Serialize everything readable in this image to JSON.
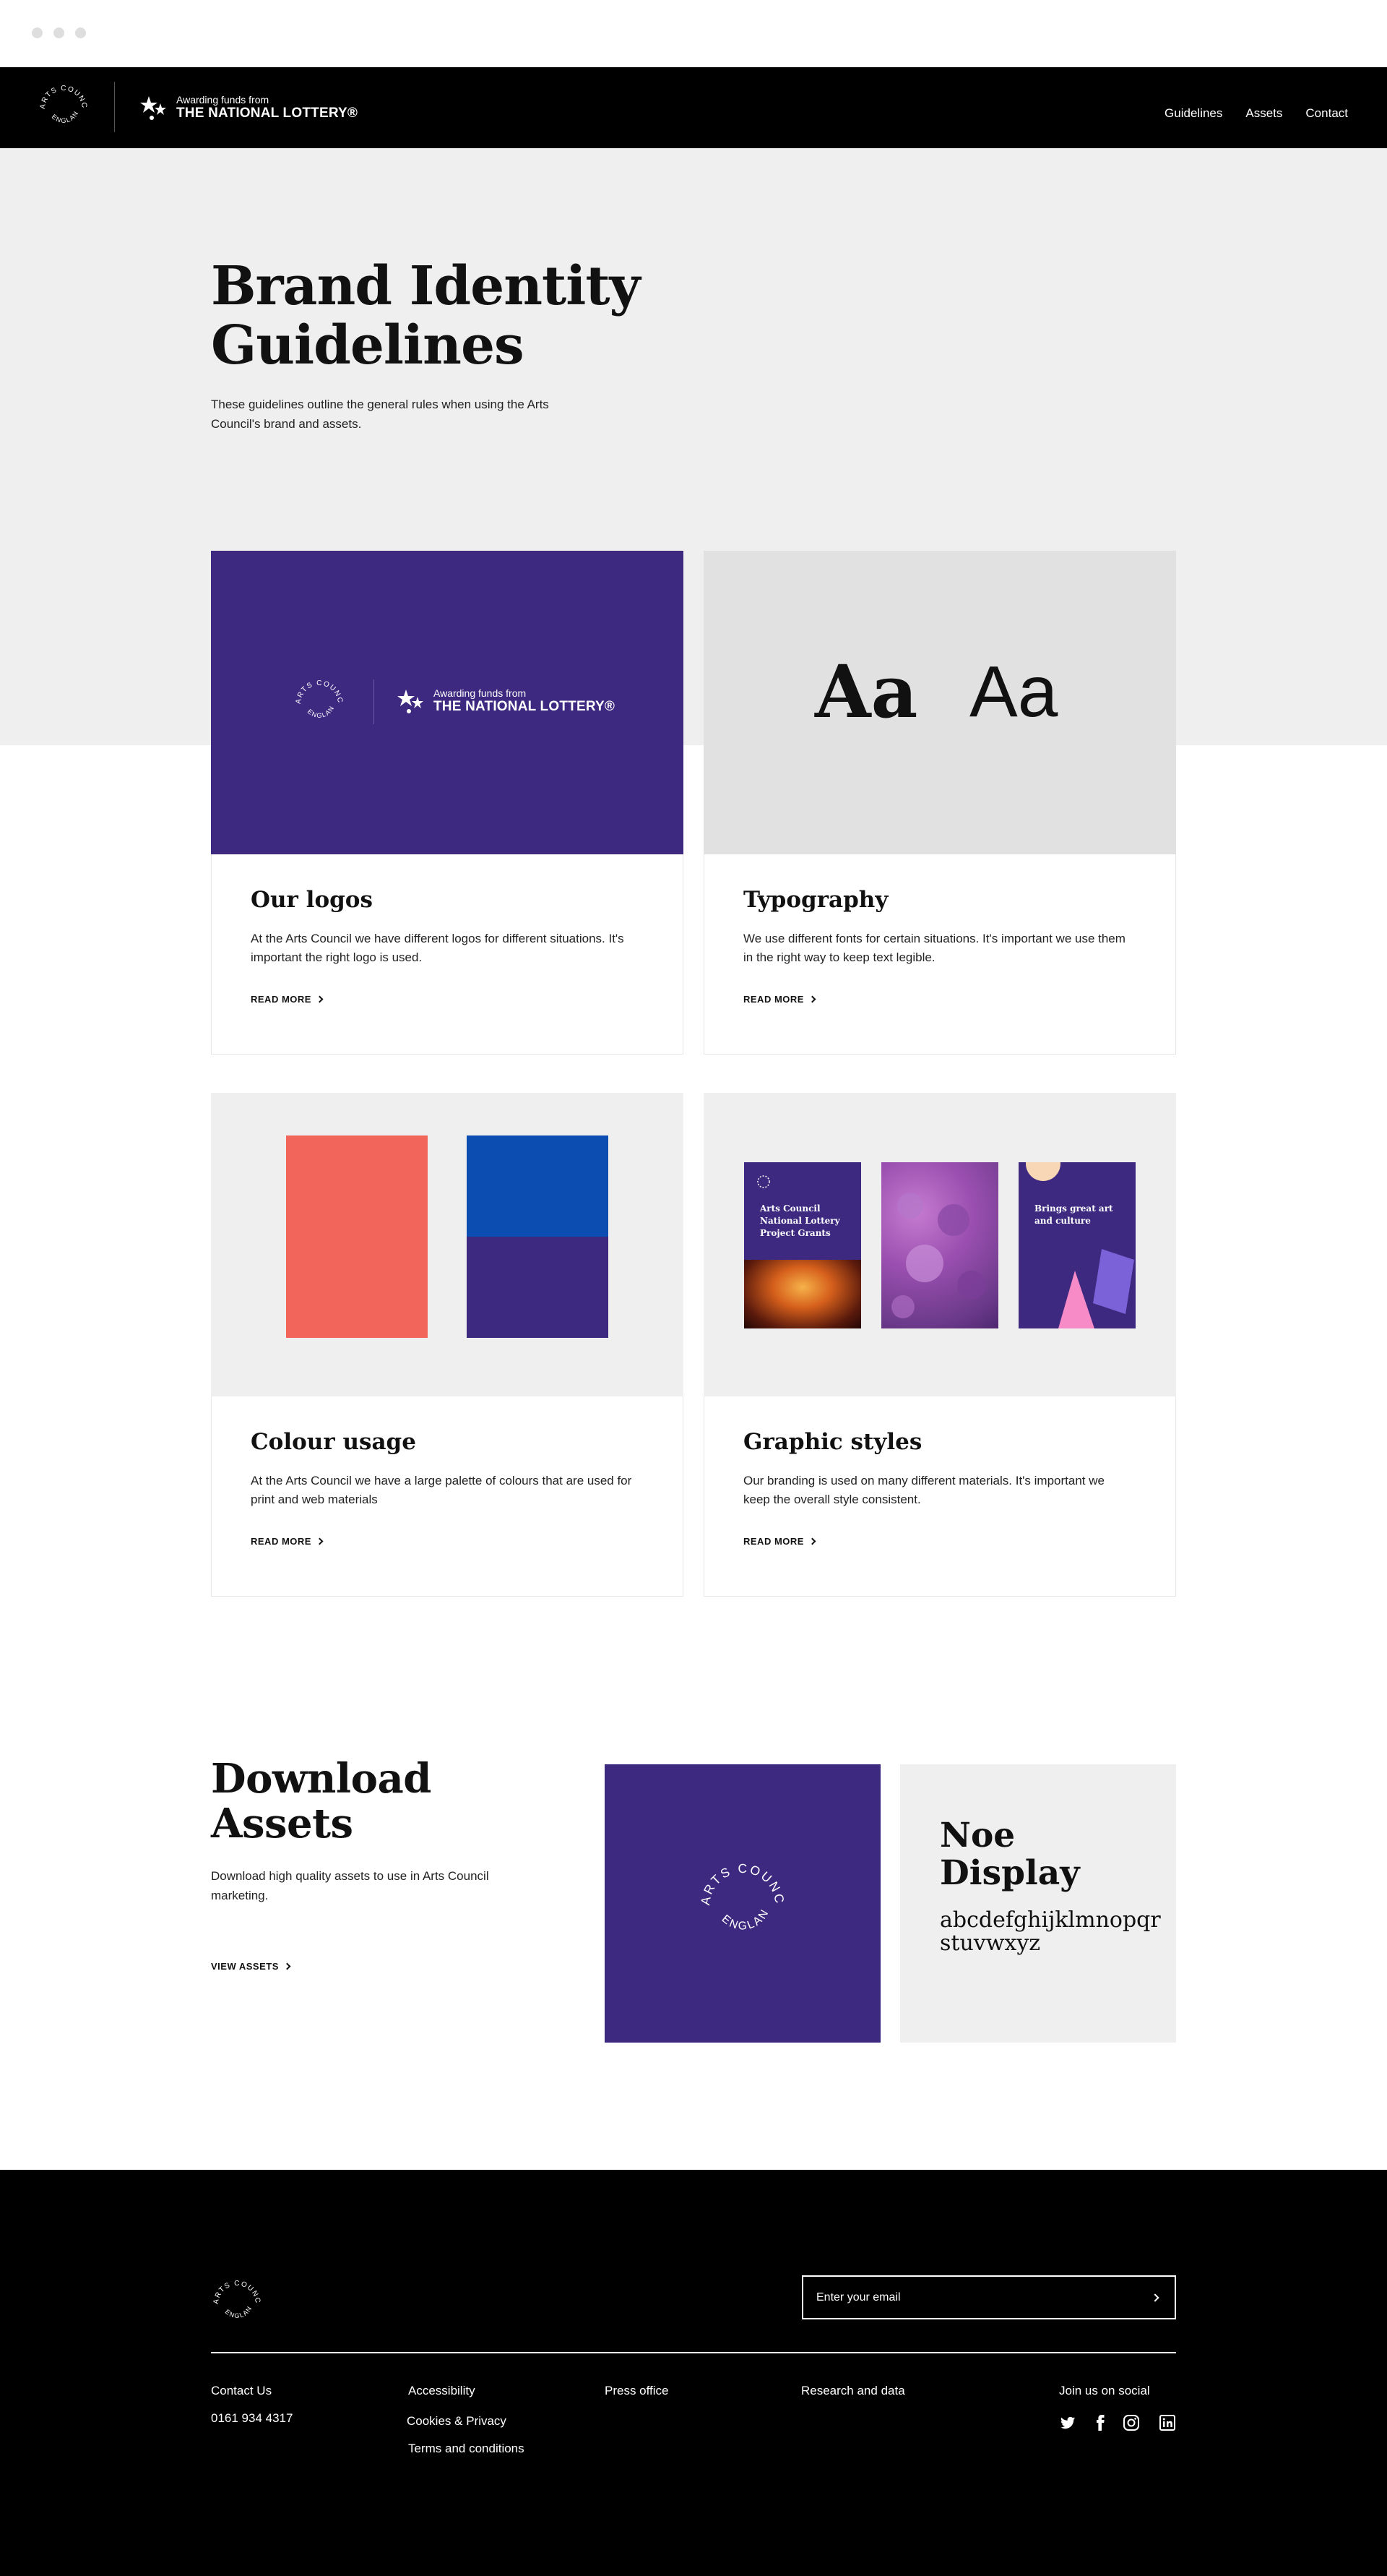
{
  "header": {
    "logo_line1": "ARTS COUNCIL",
    "logo_line2": "ENGLAND",
    "lottery_small": "Awarding funds from",
    "lottery_big": "THE NATIONAL LOTTERY®",
    "nav": [
      "Guidelines",
      "Assets",
      "Contact"
    ]
  },
  "hero": {
    "title_line1": "Brand Identity",
    "title_line2": "Guidelines",
    "subtitle": "These guidelines outline the general rules when using the Arts Council's brand and assets."
  },
  "cards": [
    {
      "title": "Our logos",
      "description": "At the Arts Council we have different logos for different situations. It's important the right logo is used.",
      "link": "READ MORE"
    },
    {
      "title": "Typography",
      "description": "We use different fonts for certain situations. It's important we use them in the right way to keep text legible.",
      "link": "READ MORE",
      "sample_serif": "Aa",
      "sample_sans": "Aa"
    },
    {
      "title": "Colour usage",
      "description": "At the Arts Council we have a large palette of colours that are used for print and web materials",
      "link": "READ MORE"
    },
    {
      "title": "Graphic styles",
      "description": "Our branding is used on many different materials. It's important we keep the overall style consistent.",
      "link": "READ MORE",
      "poster1_text": "Arts Council National Lottery Project Grants",
      "poster3_text": "Brings great art and culture"
    }
  ],
  "download": {
    "title_line1": "Download",
    "title_line2": "Assets",
    "description": "Download high quality assets to use in Arts Council marketing.",
    "link": "VIEW ASSETS",
    "font_title_line1": "Noe",
    "font_title_line2": "Display",
    "font_sample": "abcdefghijklmnopqr stuvwxyz"
  },
  "footer": {
    "email_placeholder": "Enter your email",
    "contact_label": "Contact Us",
    "phone": "0161 934 4317",
    "accessibility": "Accessibility",
    "cookies": "Cookies & Privacy",
    "terms": "Terms and conditions",
    "press": "Press office",
    "research": "Research and data",
    "social_label": "Join us on social",
    "social_icons": [
      "twitter-icon",
      "facebook-icon",
      "instagram-icon",
      "linkedin-icon"
    ]
  },
  "colors": {
    "purple": "#3d2a80",
    "coral": "#f2655b",
    "blue": "#0b4db0",
    "light_grey": "#eeefee",
    "mid_grey": "#e1e1e1",
    "black": "#000000",
    "pink": "#f68bc8",
    "lavender": "#7b62d9"
  }
}
